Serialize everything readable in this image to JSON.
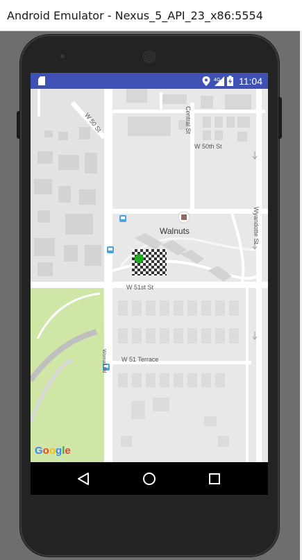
{
  "window": {
    "title": "Android Emulator - Nexus_5_API_23_x86:5554"
  },
  "statusbar": {
    "time": "11:04",
    "icons": [
      "sd-card-icon",
      "location-icon",
      "signal-4g-icon",
      "battery-charging-icon"
    ],
    "network_label": "4G",
    "color": "#3f51b5"
  },
  "map": {
    "streets": {
      "w50st": "W 50 St",
      "w50th": "W 50th St",
      "central": "Central St",
      "wyandotte": "Wyandotte St",
      "w51st": "W 51st St",
      "w51terrace": "W 51 Terrace",
      "wornall": "Wornall Rd"
    },
    "poi": {
      "name": "Walnuts"
    },
    "attribution": "Google",
    "marker": {
      "dot_color": "#1faa1f"
    },
    "park_color": "#cfe6a6"
  },
  "navbar": {
    "back": "back-icon",
    "home": "home-icon",
    "recents": "recents-icon"
  }
}
